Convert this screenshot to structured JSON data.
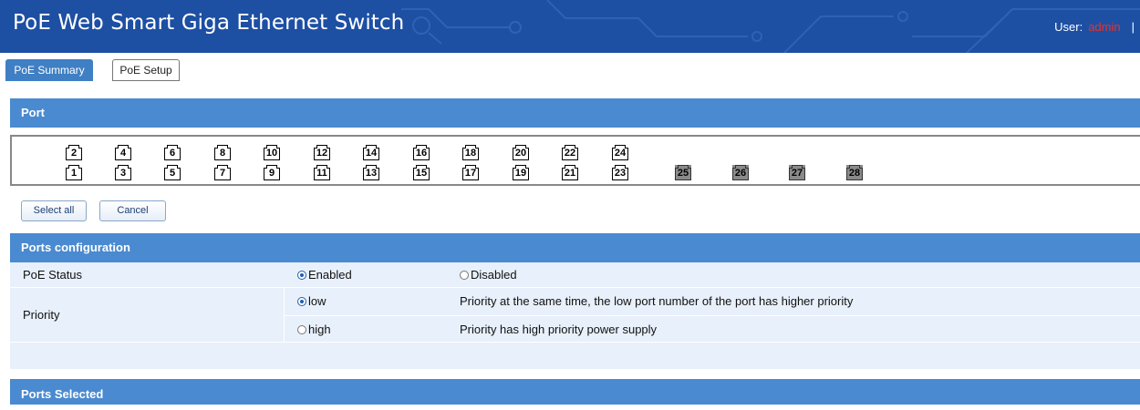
{
  "header": {
    "title": "PoE Web Smart Giga Ethernet Switch",
    "user_label": "User:",
    "user_name": "admin",
    "separator": "|"
  },
  "tabs": [
    {
      "label": "PoE Summary",
      "active": true
    },
    {
      "label": "PoE Setup",
      "active": false
    }
  ],
  "port_section": {
    "title": "Port"
  },
  "ports": {
    "top_row": [
      "2",
      "4",
      "6",
      "8",
      "10",
      "12",
      "14",
      "16",
      "18",
      "20",
      "22",
      "24"
    ],
    "bottom_row": [
      "1",
      "3",
      "5",
      "7",
      "9",
      "11",
      "13",
      "15",
      "17",
      "19",
      "21",
      "23"
    ],
    "sfp": [
      "25",
      "26",
      "27",
      "28"
    ]
  },
  "buttons": {
    "select_all": "Select all",
    "cancel": "Cancel"
  },
  "config": {
    "title": "Ports configuration",
    "poe_status": {
      "label": "PoE Status",
      "enabled": "Enabled",
      "disabled": "Disabled",
      "selected": "Enabled"
    },
    "priority": {
      "label": "Priority",
      "low": "low",
      "low_desc": "Priority at the same time, the low port number of the port has higher priority",
      "high": "high",
      "high_desc": "Priority has high priority power supply",
      "selected": "low"
    }
  },
  "ports_selected": {
    "title": "Ports Selected"
  },
  "colors": {
    "topbar": "#1d4fa3",
    "section_header": "#4a8ad0",
    "row_bg": "#e8f0fb",
    "user_name": "#e8332c"
  }
}
